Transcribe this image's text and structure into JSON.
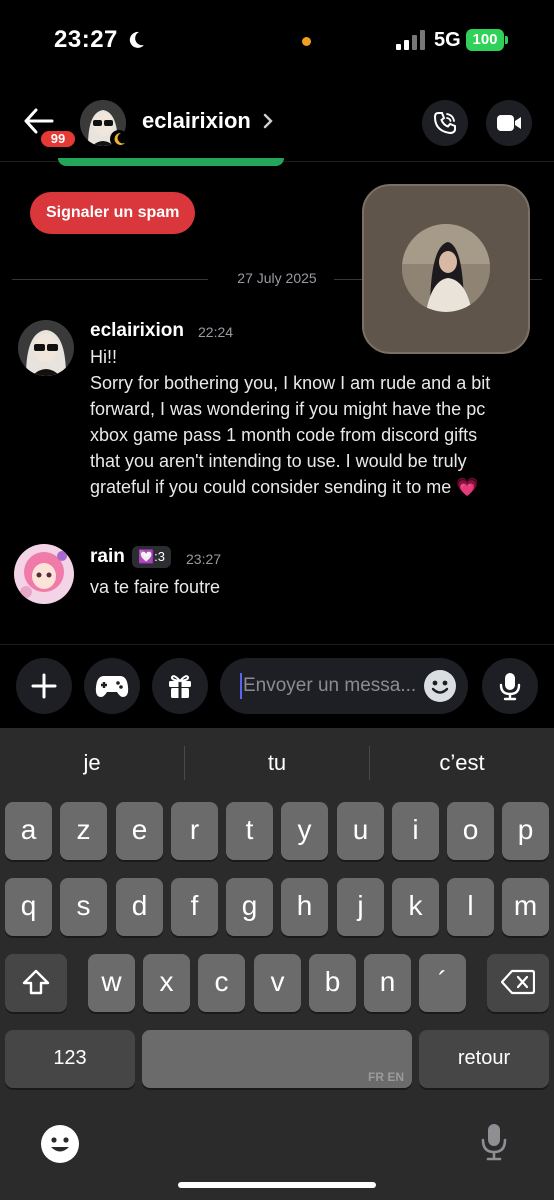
{
  "status_bar": {
    "time": "23:27",
    "network": "5G",
    "battery": "100"
  },
  "header": {
    "badge": "99",
    "username": "eclairixion"
  },
  "actions": {
    "spam_label": "Signaler un spam"
  },
  "date_separator": "27 July 2025",
  "messages": [
    {
      "author": "eclairixion",
      "time": "22:24",
      "lines": [
        "Hi!!",
        "Sorry for bothering you, I know I am rude and a bit",
        "forward, I was wondering if you might have the pc",
        "xbox game pass 1 month code from discord gifts",
        "that you aren't intending to use. I would be truly",
        "grateful if you could consider sending it to me 💗"
      ]
    },
    {
      "author": "rain",
      "tag": "💟:3",
      "time": "23:27",
      "lines": [
        "va te faire foutre"
      ]
    }
  ],
  "composer": {
    "placeholder": "Envoyer un messa..."
  },
  "keyboard": {
    "suggestions": [
      "je",
      "tu",
      "c’est"
    ],
    "row1": [
      "a",
      "z",
      "e",
      "r",
      "t",
      "y",
      "u",
      "i",
      "o",
      "p"
    ],
    "row2": [
      "q",
      "s",
      "d",
      "f",
      "g",
      "h",
      "j",
      "k",
      "l",
      "m"
    ],
    "row3": [
      "w",
      "x",
      "c",
      "v",
      "b",
      "n",
      "´"
    ],
    "numbers_label": "123",
    "language_label": "FR EN",
    "return_label": "retour"
  }
}
